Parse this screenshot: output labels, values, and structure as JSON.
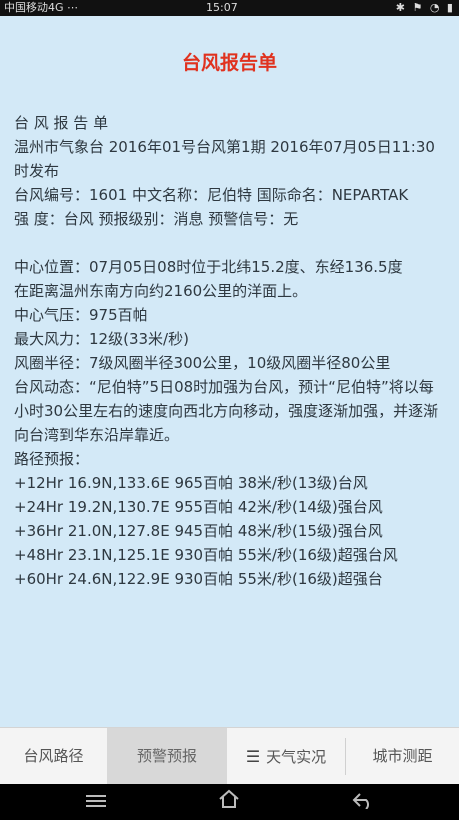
{
  "status_bar": {
    "carrier": "中国移动4G",
    "signal_icons": "⋯",
    "time": "15:07",
    "right_icons": "✱ ⚑ ◔ ▮"
  },
  "page": {
    "title": "台风报告单",
    "report_lines": [
      "台 风 报 告 单",
      "温州市气象台 2016年01号台风第1期 2016年07月05日11:30时发布",
      "台风编号：1601 中文名称：尼伯特 国际命名：NEPARTAK",
      "强 度：台风 预报级别：消息 预警信号：无",
      "",
      "中心位置：07月05日08时位于北纬15.2度、东经136.5度",
      "在距离温州东南方向约2160公里的洋面上。",
      "中心气压：975百帕",
      "最大风力：12级(33米/秒)",
      "风圈半径：7级风圈半径300公里，10级风圈半径80公里",
      "台风动态：“尼伯特”5日08时加强为台风，预计“尼伯特”将以每小时30公里左右的速度向西北方向移动，强度逐渐加强，并逐渐向台湾到华东沿岸靠近。",
      "路径预报：",
      "+12Hr 16.9N,133.6E 965百帕 38米/秒(13级)台风",
      "+24Hr 19.2N,130.7E 955百帕 42米/秒(14级)强台风",
      "+36Hr 21.0N,127.8E 945百帕 48米/秒(15级)强台风",
      "+48Hr 23.1N,125.1E 930百帕 55米/秒(16级)超强台风",
      "+60Hr 24.6N,122.9E 930百帕 55米/秒(16级)超强台"
    ]
  },
  "tabs": [
    {
      "label": "台风路径",
      "active": false
    },
    {
      "label": "预警预报",
      "active": true
    },
    {
      "label": "天气实况",
      "active": false,
      "icon": "menu-icon"
    },
    {
      "label": "城市测距",
      "active": false
    }
  ],
  "nav": {
    "menu_icon": "menu-icon",
    "home_icon": "home-icon",
    "back_icon": "back-icon"
  }
}
